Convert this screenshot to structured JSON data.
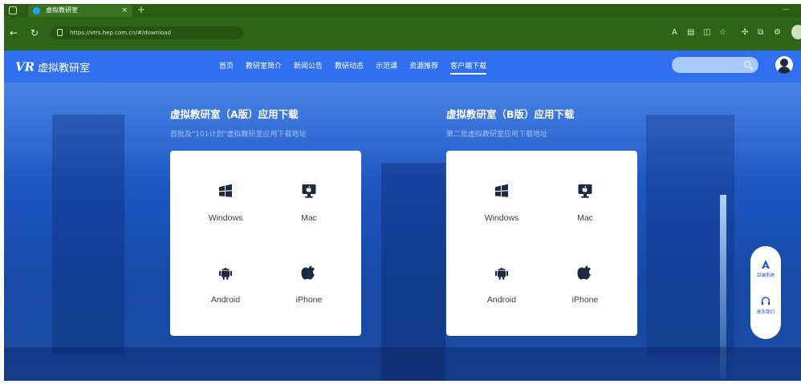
{
  "browser": {
    "tab_title": "虚拟教研室",
    "tab_close": "×",
    "new_tab": "+",
    "url": "https://vtrs.hep.com.cn/#/download",
    "icons": [
      "back-icon",
      "refresh-icon",
      "lock-icon",
      "read-aloud-icon",
      "reader-icon",
      "split-icon",
      "favorite-icon",
      "extensions-icon",
      "collections-icon",
      "tools-icon",
      "profile-icon"
    ]
  },
  "header": {
    "logo_mark": "VR",
    "logo_text": "虚拟教研室",
    "menu": [
      {
        "label": "首页"
      },
      {
        "label": "教研室简介"
      },
      {
        "label": "新闻公告"
      },
      {
        "label": "教研动态"
      },
      {
        "label": "示范课"
      },
      {
        "label": "资源推荐"
      },
      {
        "label": "客户端下载",
        "active": true
      }
    ],
    "accent": "#2f6ff0"
  },
  "panels": [
    {
      "title": "虚拟教研室（A版）应用下载",
      "subtitle": "首批及\"101计划\"虚拟教研室应用下载地址",
      "downloads": [
        {
          "label": "Windows",
          "icon": "windows-icon"
        },
        {
          "label": "Mac",
          "icon": "mac-icon"
        },
        {
          "label": "Android",
          "icon": "android-icon"
        },
        {
          "label": "iPhone",
          "icon": "apple-icon"
        }
      ]
    },
    {
      "title": "虚拟教研室（B版）应用下载",
      "subtitle": "第二批虚拟教研室应用下载地址",
      "downloads": [
        {
          "label": "Windows",
          "icon": "windows-icon"
        },
        {
          "label": "Mac",
          "icon": "mac-icon"
        },
        {
          "label": "Android",
          "icon": "android-icon"
        },
        {
          "label": "iPhone",
          "icon": "apple-icon"
        }
      ]
    }
  ],
  "side_widget": {
    "items": [
      {
        "label": "后端系统",
        "icon": "admin-system-icon"
      },
      {
        "label": "联系我们",
        "icon": "headset-icon"
      }
    ]
  },
  "colors": {
    "icon_dark": "#1d2a44",
    "icon_accent": "#1f55c8",
    "browser_chrome": "#2d6415"
  }
}
